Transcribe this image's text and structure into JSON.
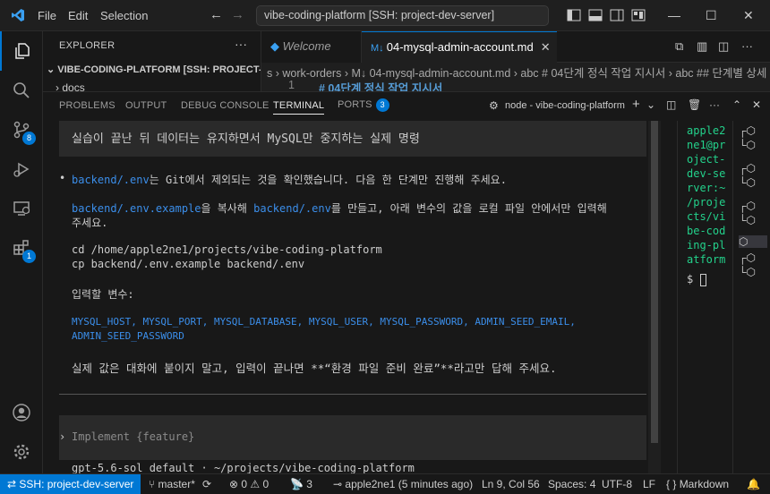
{
  "titlebar": {
    "menu": [
      "File",
      "Edit",
      "Selection"
    ],
    "search": "vibe-coding-platform [SSH: project-dev-server]"
  },
  "activity_badges": {
    "source_control": "8",
    "extensions": "1"
  },
  "sidebar": {
    "title": "EXPLORER",
    "more": "···",
    "root": "VIBE-CODING-PLATFORM [SSH: PROJECT-D...",
    "docs": "docs"
  },
  "tabs": [
    {
      "label": "Welcome",
      "active": false
    },
    {
      "label": "04-mysql-admin-account.md",
      "active": true
    }
  ],
  "breadcrumb": "s › work-orders › M↓ 04-mysql-admin-account.md › abc # 04단계 정식 작업 지시서 › abc ## 단계별 상세",
  "editor_line": {
    "number": "1",
    "text": "# 04단계 정식 작업 지시서"
  },
  "panel": {
    "tabs": [
      "PROBLEMS",
      "OUTPUT",
      "DEBUG CONSOLE",
      "TERMINAL",
      "PORTS"
    ],
    "ports_badge": "3",
    "terminal_name": "node - vibe-coding-platform"
  },
  "terminal": {
    "heading": "실습이 끝난 뒤 데이터는 유지하면서 MySQL만 중지하는 실제 명령",
    "bullet_a": "backend/.env",
    "bullet_b": "는 Git에서 제외되는 것을 확인했습니다. 다음 한 단계만 진행해 주세요.",
    "copy_a": "backend/.env.example",
    "copy_b": "을 복사해 ",
    "copy_c": "backend/.env",
    "copy_d": "를 만들고, 아래 변수의 값을 로컬 파일 안에서만 입력해",
    "copy_e": "주세요.",
    "cmd1": "cd /home/apple2ne1/projects/vibe-coding-platform",
    "cmd2": "cp backend/.env.example backend/.env",
    "vars_label": "입력할 변수:",
    "vars_line1": "MYSQL_HOST, MYSQL_PORT, MYSQL_DATABASE, MYSQL_USER, MYSQL_PASSWORD, ADMIN_SEED_EMAIL,",
    "vars_line2": "ADMIN_SEED_PASSWORD",
    "note": "실제 값은 대화에 붙이지 말고, 입력이 끝나면 **“환경 파일 준비 완료”**라고만 답해 주세요.",
    "input_placeholder": "Implement {feature}",
    "footer": "gpt-5.6-sol default · ~/projects/vibe-coding-platform"
  },
  "terminal2": {
    "lines": [
      "apple2",
      "ne1@pr",
      "oject-",
      "dev-se",
      "rver:~",
      "/proje",
      "cts/vi",
      "be-cod",
      "ing-pl",
      "atform"
    ],
    "prompt": "$"
  },
  "statusbar": {
    "remote": "SSH: project-dev-server",
    "branch": "master*",
    "errors": "0",
    "warnings": "0",
    "ports": "3",
    "blame": "apple2ne1 (5 minutes ago)",
    "position": "Ln 9, Col 56",
    "spaces": "Spaces: 4",
    "encoding": "UTF-8",
    "eol": "LF",
    "language": "Markdown"
  }
}
